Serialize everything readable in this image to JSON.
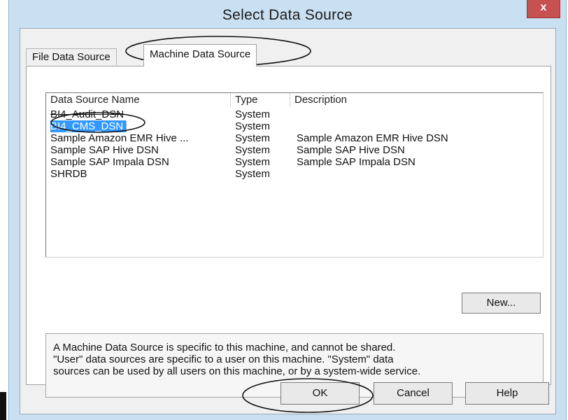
{
  "window": {
    "title": "Select Data Source",
    "close_glyph": "x"
  },
  "tabs": [
    {
      "label": "File Data Source",
      "active": false
    },
    {
      "label": "Machine Data Source",
      "active": true
    }
  ],
  "list": {
    "columns": [
      "Data Source Name",
      "Type",
      "Description"
    ],
    "rows": [
      {
        "name": "BI4_Audit_DSN",
        "type": "System",
        "description": ""
      },
      {
        "name": "BI4_CMS_DSN",
        "type": "System",
        "description": "",
        "selected": true
      },
      {
        "name": "Sample Amazon EMR Hive ...",
        "type": "System",
        "description": "Sample Amazon EMR Hive DSN"
      },
      {
        "name": "Sample SAP Hive DSN",
        "type": "System",
        "description": "Sample SAP Hive DSN"
      },
      {
        "name": "Sample SAP Impala DSN",
        "type": "System",
        "description": "Sample SAP Impala DSN"
      },
      {
        "name": "SHRDB",
        "type": "System",
        "description": ""
      }
    ]
  },
  "buttons": {
    "new": "New...",
    "ok": "OK",
    "cancel": "Cancel",
    "help": "Help"
  },
  "info_text": "A Machine Data Source is specific to this machine, and cannot be shared.\n\"User\" data sources are specific to a user on this machine.  \"System\" data\nsources can be used by all users on this machine, or by a system-wide service.",
  "colors": {
    "selection": "#3399ff",
    "close_button": "#c75050",
    "frame": "#c9e0f2"
  }
}
